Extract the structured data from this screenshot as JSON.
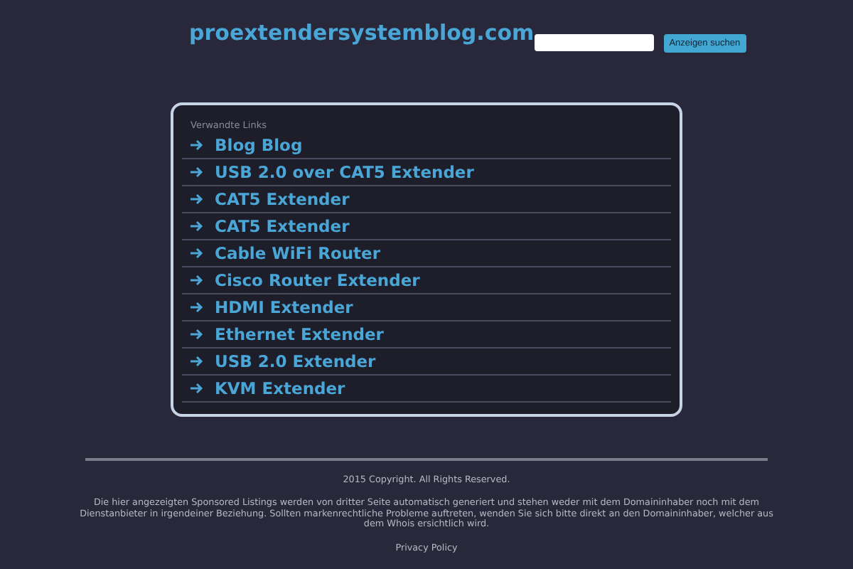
{
  "header": {
    "site_title": "proextendersystemblog.com",
    "search_button": "Anzeigen suchen"
  },
  "links": {
    "heading": "Verwandte Links",
    "items": [
      {
        "label": "Blog Blog"
      },
      {
        "label": "USB 2.0 over CAT5 Extender"
      },
      {
        "label": "CAT5 Extender"
      },
      {
        "label": "CAT5 Extender"
      },
      {
        "label": "Cable WiFi Router"
      },
      {
        "label": "Cisco Router Extender"
      },
      {
        "label": "HDMI Extender"
      },
      {
        "label": "Ethernet Extender"
      },
      {
        "label": "USB 2.0 Extender"
      },
      {
        "label": "KVM Extender"
      }
    ]
  },
  "footer": {
    "copyright": "2015 Copyright. All Rights Reserved.",
    "disclaimer": "Die hier angezeigten Sponsored Listings werden von dritter Seite automatisch generiert und stehen weder mit dem Domaininhaber noch mit dem Dienstanbieter in irgendeiner Beziehung. Sollten markenrechtliche Probleme auftreten, wenden Sie sich bitte direkt an den Domaininhaber, welcher aus dem Whois ersichtlich wird.",
    "privacy_link": "Privacy Policy"
  }
}
